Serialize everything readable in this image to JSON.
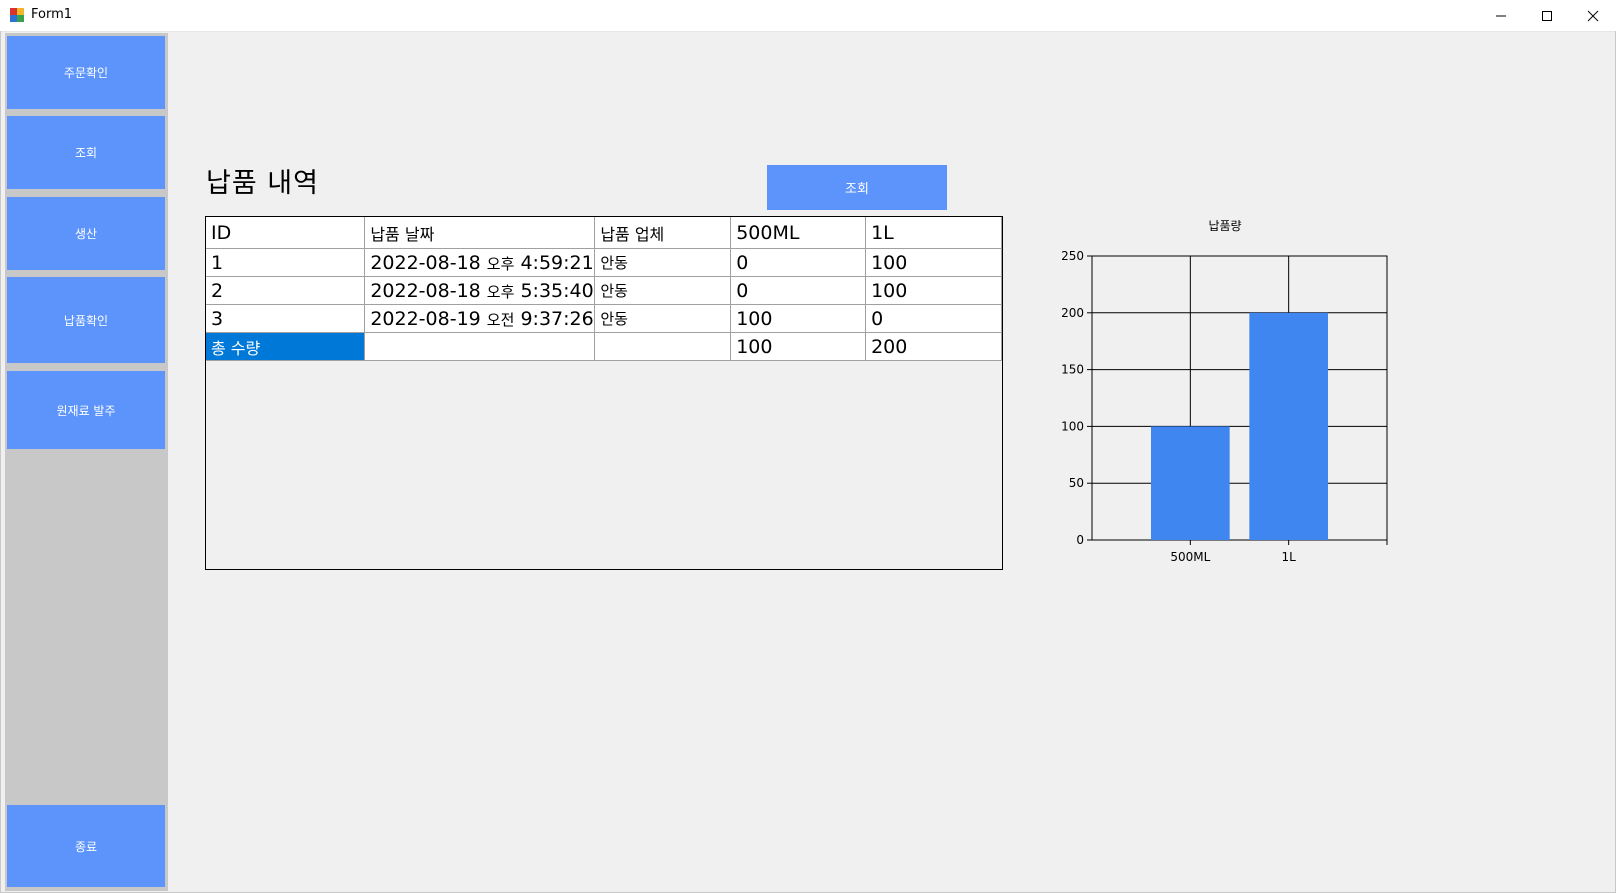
{
  "window": {
    "title": "Form1",
    "minimize_icon": "minimize-icon",
    "maximize_icon": "maximize-icon",
    "close_icon": "close-icon"
  },
  "sidebar": {
    "items": [
      {
        "label": "주문확인"
      },
      {
        "label": "조회"
      },
      {
        "label": "생산"
      },
      {
        "label": "납품확인"
      },
      {
        "label": "원재료 발주"
      }
    ],
    "exit_label": "종료",
    "button_color": "#5c94fc",
    "panel_color": "#c8c8c8"
  },
  "main": {
    "heading": "납품 내역",
    "query_button_label": "조회"
  },
  "table": {
    "columns": [
      "ID",
      "납품 날짜",
      "납품 업체",
      "500ML",
      "1L"
    ],
    "rows": [
      {
        "id": "1",
        "date": "2022-08-18",
        "ampm": "오후",
        "time": "4:59:21",
        "company": "안동",
        "ml500": "0",
        "l1": "100"
      },
      {
        "id": "2",
        "date": "2022-08-18",
        "ampm": "오후",
        "time": "5:35:40",
        "company": "안동",
        "ml500": "0",
        "l1": "100"
      },
      {
        "id": "3",
        "date": "2022-08-19",
        "ampm": "오전",
        "time": "9:37:26",
        "company": "안동",
        "ml500": "100",
        "l1": "0"
      }
    ],
    "total": {
      "label": "총 수량",
      "ml500": "100",
      "l1": "200"
    },
    "selected_color": "#0078d7"
  },
  "chart_data": {
    "type": "bar",
    "title": "납품량",
    "categories": [
      "500ML",
      "1L"
    ],
    "values": [
      100,
      200
    ],
    "ylim": [
      0,
      250
    ],
    "yticks": [
      0,
      50,
      100,
      150,
      200,
      250
    ],
    "grid": true,
    "bar_color": "#3f86f0"
  }
}
